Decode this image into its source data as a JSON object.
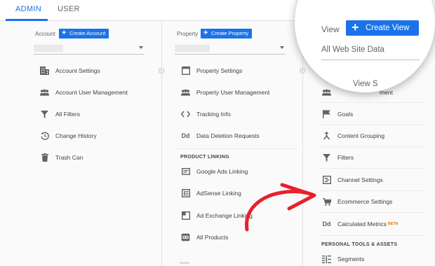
{
  "tabs": {
    "admin": "ADMIN",
    "user": "USER"
  },
  "account": {
    "label": "Account",
    "create_label": "Create Account",
    "items": [
      "Account Settings",
      "Account User Management",
      "All Filters",
      "Change History",
      "Trash Can"
    ]
  },
  "property": {
    "label": "Property",
    "create_label": "Create Property",
    "items": [
      "Property Settings",
      "Property User Management",
      "Tracking Info",
      "Data Deletion Requests"
    ],
    "linking_heading": "PRODUCT LINKING",
    "linking_items": [
      "Google Ads Linking",
      "AdSense Linking",
      "Ad Exchange Linking",
      "All Products"
    ]
  },
  "view": {
    "label": "View",
    "create_label": "Create View",
    "selected": "All Web Site Data",
    "partial_text": "View S",
    "partial_item": "ment",
    "items": [
      "Goals",
      "Content Grouping",
      "Filters",
      "Channel Settings",
      "Ecommerce Settings",
      "Calculated Metrics"
    ],
    "beta": "BETA",
    "tools_heading": "PERSONAL TOOLS & ASSETS",
    "tools_items": [
      "Segments"
    ]
  },
  "colors": {
    "accent": "#1a73e8",
    "arrow": "#e8212a",
    "beta": "#e8710a"
  }
}
